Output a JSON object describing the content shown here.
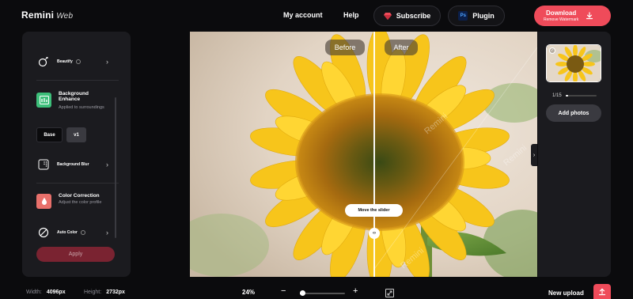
{
  "header": {
    "logo": "Remini",
    "logo_sub": "Web",
    "nav": {
      "account": "My account",
      "help": "Help"
    },
    "subscribe_label": "Subscribe",
    "plugin_label": "Plugin",
    "plugin_badge": "Ps",
    "download": {
      "label": "Download",
      "sublabel": "Remove Watermark"
    }
  },
  "tools": {
    "beautify": {
      "label": "Beautify"
    },
    "background_enhance": {
      "title": "Background Enhance",
      "desc": "Applied to surroundings",
      "modes": [
        "Base",
        "v1"
      ],
      "selected_mode": "v1"
    },
    "background_blur": {
      "label": "Background Blur"
    },
    "color_correction": {
      "title": "Color Correction",
      "desc": "Adjust the color profile"
    },
    "auto_color": {
      "label": "Auto Color"
    },
    "apply_label": "Apply"
  },
  "viewer": {
    "before_label": "Before",
    "after_label": "After",
    "slider_hint": "Move the slider",
    "watermark": "Remini",
    "slider_fraction": 0.53
  },
  "sidebar_right": {
    "counter": "1/15",
    "counter_fraction": 0.067,
    "add_photos_label": "Add photos"
  },
  "footer": {
    "width_label": "Width:",
    "width_value": "4096px",
    "height_label": "Height:",
    "height_value": "2732px",
    "zoom_value": "24%",
    "zoom_fraction": 0.05,
    "new_upload_label": "New upload"
  },
  "colors": {
    "accent": "#ef4b5a",
    "apply_disabled": "#7a2331",
    "panel": "#1b1b1f",
    "background": "#0b0b0d"
  }
}
